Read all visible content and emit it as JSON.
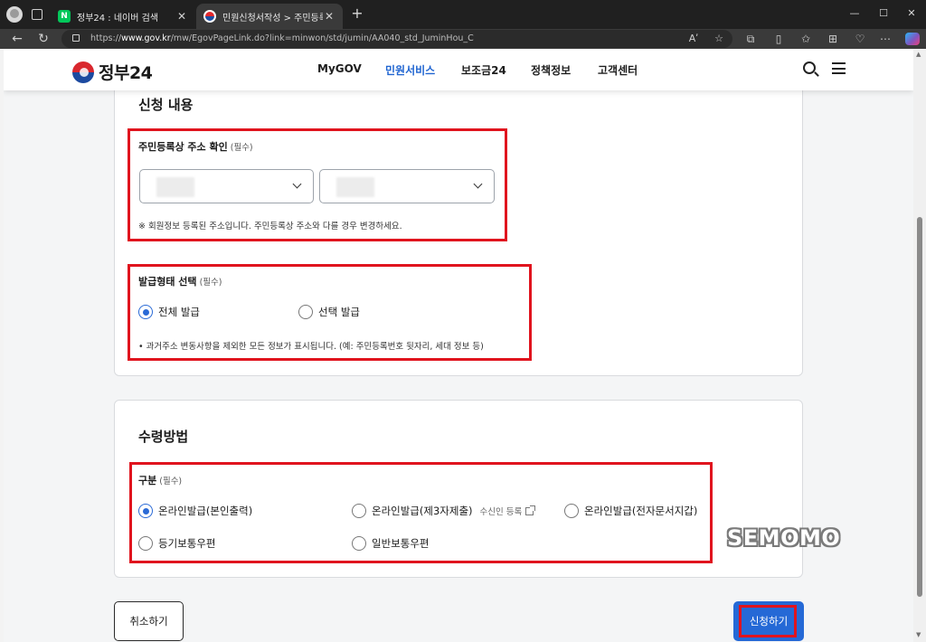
{
  "browser": {
    "tabs": [
      {
        "title": "정부24 : 네이버 검색",
        "favicon": "naver-icon",
        "active": false
      },
      {
        "title": "민원신청서작성 > 주민등록표 등",
        "favicon": "gov24-icon",
        "active": true
      }
    ],
    "url": {
      "prefix": "https://",
      "host": "www.gov.kr",
      "path": "/mw/EgovPageLink.do?link=minwon/std/jumin/AA040_std_JuminHou_C"
    },
    "reader_label": "Aʹ"
  },
  "header": {
    "logo_text": "정부24",
    "nav": [
      "MyGOV",
      "민원서비스",
      "보조금24",
      "정책정보",
      "고객센터"
    ],
    "active_nav": "민원서비스"
  },
  "section_application": {
    "title": "신청 내용",
    "address": {
      "label": "주민등록상 주소 확인",
      "required": "(필수)",
      "hint": "※ 회원정보 등록된 주소입니다. 주민등록상 주소와 다를 경우 변경하세요."
    },
    "issue_type": {
      "label": "발급형태 선택",
      "required": "(필수)",
      "options": [
        "전체 발급",
        "선택 발급"
      ],
      "selected": "전체 발급",
      "hint": "• 과거주소 변동사항을 제외한 모든 정보가 표시됩니다. (예: 주민등록번호 뒷자리, 세대 정보 등)"
    }
  },
  "section_receive": {
    "title": "수령방법",
    "method": {
      "label": "구분",
      "required": "(필수)",
      "options": [
        "온라인발급(본인출력)",
        "온라인발급(제3자제출)",
        "온라인발급(전자문서지갑)",
        "등기보통우편",
        "일반보통우편"
      ],
      "sub_link": "수신인 등록",
      "selected": "온라인발급(본인출력)"
    }
  },
  "actions": {
    "cancel": "취소하기",
    "submit": "신청하기"
  },
  "watermark": "SEMOMO",
  "colors": {
    "highlight": "#e0141e",
    "primary": "#2569d6",
    "active_nav": "#2065d1"
  }
}
